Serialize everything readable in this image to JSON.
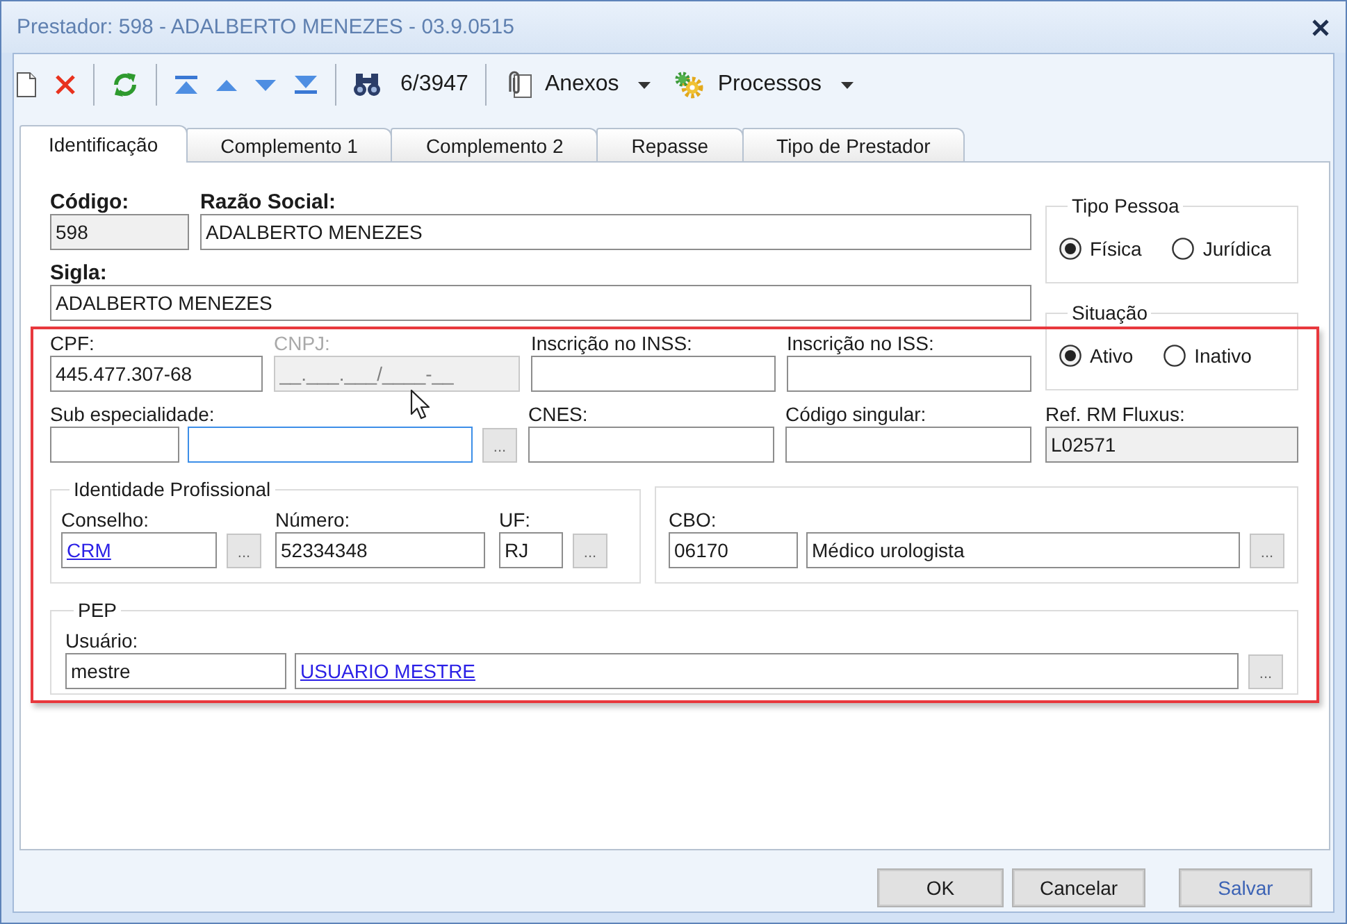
{
  "window": {
    "title": "Prestador: 598 - ADALBERTO MENEZES - 03.9.0515"
  },
  "toolbar": {
    "record_counter": "6/3947",
    "menus": [
      {
        "label": "Anexos"
      },
      {
        "label": "Processos"
      }
    ]
  },
  "tabs": [
    {
      "label": "Identificação",
      "selected": true
    },
    {
      "label": "Complemento 1",
      "selected": false
    },
    {
      "label": "Complemento 2",
      "selected": false
    },
    {
      "label": "Repasse",
      "selected": false
    },
    {
      "label": "Tipo de Prestador",
      "selected": false
    }
  ],
  "form": {
    "codigo": {
      "label": "Código:",
      "required": true,
      "disabled": false,
      "inputs": [
        {
          "value": "598",
          "readonly": true,
          "focused": false,
          "link": false
        }
      ]
    },
    "razao_social": {
      "label": "Razão Social:",
      "required": true,
      "disabled": false,
      "inputs": [
        {
          "value": "ADALBERTO MENEZES",
          "readonly": false,
          "focused": false,
          "link": false
        }
      ]
    },
    "tipo_pessoa": {
      "title": "Tipo Pessoa",
      "options": [
        {
          "label": "Física",
          "selected": true
        },
        {
          "label": "Jurídica",
          "selected": false
        }
      ]
    },
    "sigla": {
      "label": "Sigla:",
      "required": true,
      "disabled": false,
      "inputs": [
        {
          "value": "ADALBERTO MENEZES",
          "readonly": false,
          "focused": false,
          "link": false
        }
      ]
    },
    "situacao": {
      "title": "Situação",
      "options": [
        {
          "label": "Ativo",
          "selected": true
        },
        {
          "label": "Inativo",
          "selected": false
        }
      ]
    },
    "cpf": {
      "label": "CPF:",
      "required": false,
      "disabled": false,
      "inputs": [
        {
          "value": "445.477.307-68",
          "readonly": false,
          "focused": false,
          "link": false
        }
      ]
    },
    "cnpj": {
      "label": "CNPJ:",
      "required": false,
      "disabled": true,
      "inputs": [
        {
          "placeholder": "__.___.___/____-__",
          "readonly": true,
          "focused": false
        }
      ]
    },
    "inscricao_inss": {
      "label": "Inscrição no INSS:",
      "required": false,
      "disabled": false,
      "inputs": [
        {
          "readonly": false,
          "focused": false
        }
      ]
    },
    "inscricao_iss": {
      "label": "Inscrição no ISS:",
      "required": false,
      "disabled": false,
      "inputs": [
        {
          "readonly": false,
          "focused": false
        }
      ]
    },
    "sub_especialidade": {
      "label": "Sub especialidade:",
      "required": false,
      "disabled": false,
      "inputs": [
        {
          "readonly": false,
          "focused": false
        },
        {
          "readonly": false,
          "focused": true
        }
      ],
      "button": "..."
    },
    "cnes": {
      "label": "CNES:",
      "required": false,
      "disabled": false,
      "inputs": [
        {
          "readonly": false,
          "focused": false
        }
      ]
    },
    "codigo_singular": {
      "label": "Código singular:",
      "required": false,
      "disabled": false,
      "inputs": [
        {
          "readonly": false,
          "focused": false
        }
      ]
    },
    "ref_rm_fluxus": {
      "label": "Ref. RM Fluxus:",
      "required": false,
      "disabled": false,
      "inputs": [
        {
          "value": "L02571",
          "readonly": true,
          "focused": false,
          "link": false
        }
      ]
    },
    "identidade_profissional": {
      "title": "Identidade Profissional",
      "fields": [
        {
          "label": "Conselho:",
          "required": false,
          "disabled": false,
          "inputs": [
            {
              "value": "CRM",
              "readonly": false,
              "focused": false,
              "link": true
            }
          ],
          "button": "..."
        },
        {
          "label": "Número:",
          "required": false,
          "disabled": false,
          "inputs": [
            {
              "value": "52334348",
              "readonly": false,
              "focused": false,
              "link": false
            }
          ]
        },
        {
          "label": "UF:",
          "required": false,
          "disabled": false,
          "inputs": [
            {
              "value": "RJ",
              "readonly": false,
              "focused": false,
              "link": false
            }
          ],
          "button": "..."
        }
      ]
    },
    "cbo_box": {
      "fields": [
        {
          "label": "CBO:",
          "required": false,
          "disabled": false,
          "inputs": [
            {
              "value": "06170",
              "readonly": false,
              "focused": false,
              "link": false
            },
            {
              "value": "Médico urologista",
              "readonly": false,
              "focused": false,
              "link": false
            }
          ],
          "button": "..."
        }
      ]
    },
    "pep": {
      "title": "PEP",
      "fields": [
        {
          "label": "Usuário:",
          "required": false,
          "disabled": false,
          "inputs": [
            {
              "value": "mestre",
              "readonly": false,
              "focused": false,
              "link": false
            },
            {
              "value": "USUARIO MESTRE",
              "readonly": false,
              "focused": false,
              "link": true
            }
          ],
          "button": "..."
        }
      ]
    }
  },
  "buttons": [
    {
      "label": "OK",
      "default": false
    },
    {
      "label": "Cancelar",
      "default": false
    },
    {
      "label": "Salvar",
      "default": true
    }
  ]
}
